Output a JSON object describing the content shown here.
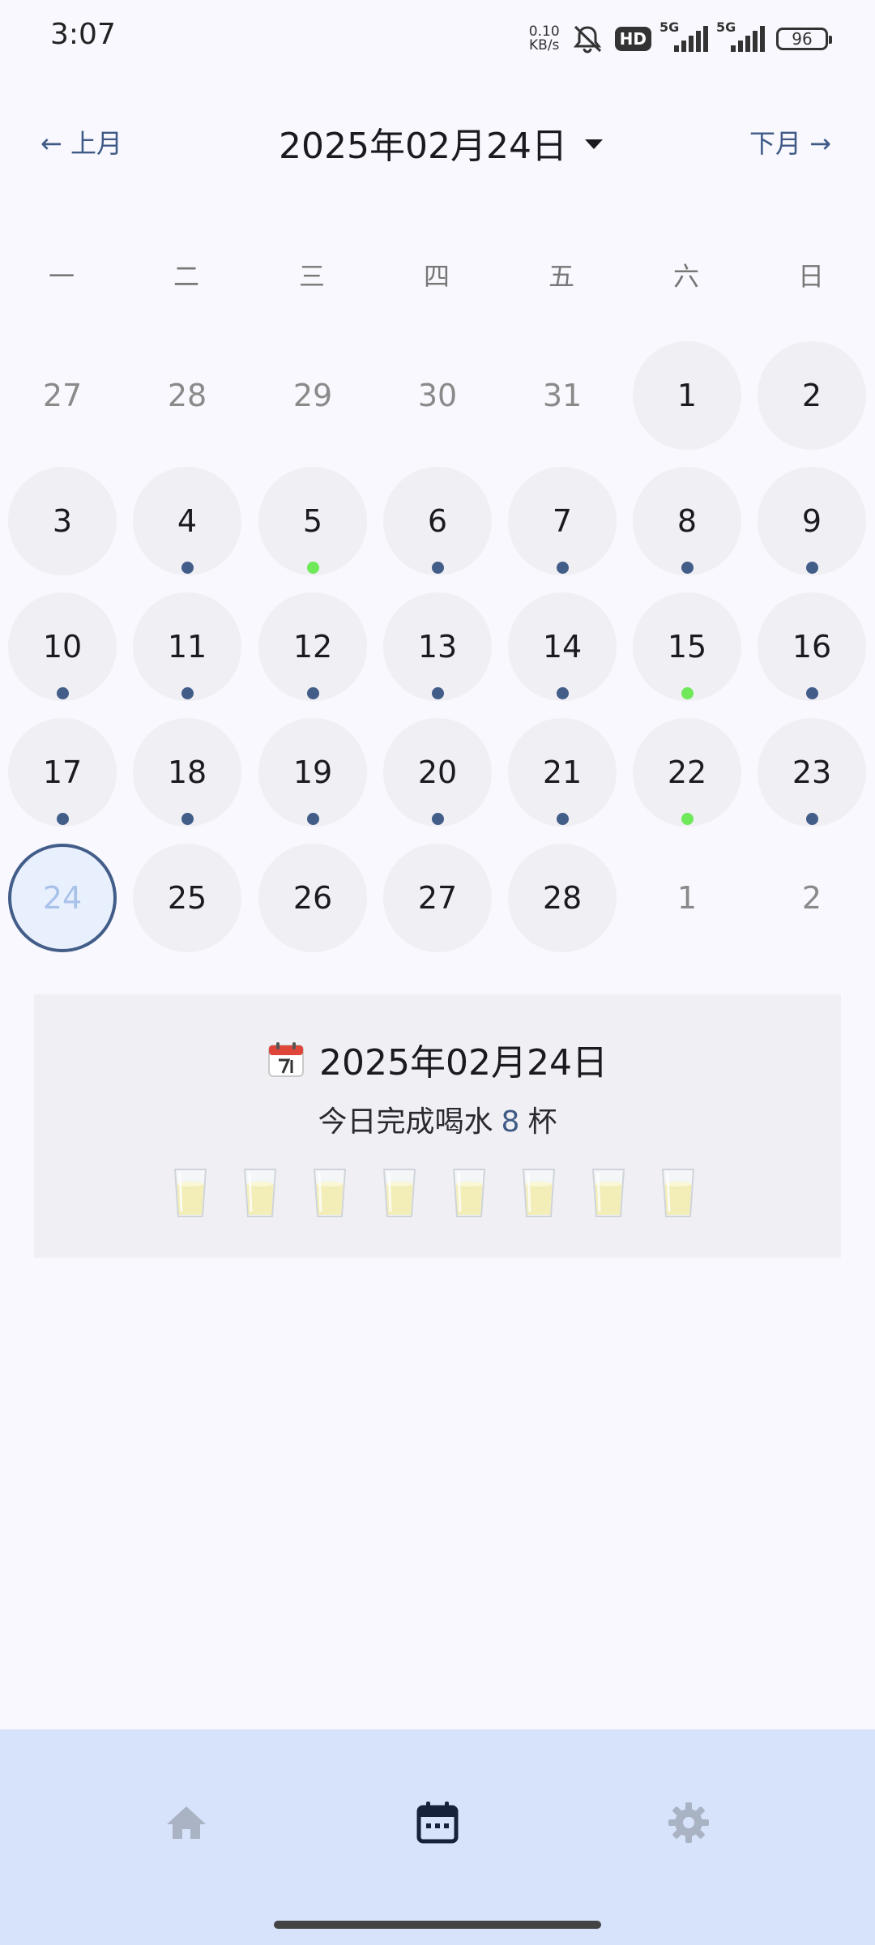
{
  "status_bar": {
    "time": "3:07",
    "speed_value": "0.10",
    "speed_unit": "KB/s",
    "hd_label": "HD",
    "signal1_label": "5G",
    "signal2_label": "5G",
    "battery": "96",
    "icons": [
      "mute-icon",
      "hd-icon",
      "signal-icon",
      "signal-icon",
      "battery-icon"
    ]
  },
  "header": {
    "prev_label": "← 上月",
    "next_label": "下月 →",
    "current_date": "2025年02月24日"
  },
  "weekdays": [
    "一",
    "二",
    "三",
    "四",
    "五",
    "六",
    "日"
  ],
  "calendar": {
    "rows": [
      [
        {
          "d": "27",
          "m": "prev"
        },
        {
          "d": "28",
          "m": "prev"
        },
        {
          "d": "29",
          "m": "prev"
        },
        {
          "d": "30",
          "m": "prev"
        },
        {
          "d": "31",
          "m": "prev"
        },
        {
          "d": "1",
          "m": "cur"
        },
        {
          "d": "2",
          "m": "cur"
        }
      ],
      [
        {
          "d": "3",
          "m": "cur"
        },
        {
          "d": "4",
          "m": "cur",
          "dot": "blue"
        },
        {
          "d": "5",
          "m": "cur",
          "dot": "green"
        },
        {
          "d": "6",
          "m": "cur",
          "dot": "blue"
        },
        {
          "d": "7",
          "m": "cur",
          "dot": "blue"
        },
        {
          "d": "8",
          "m": "cur",
          "dot": "blue"
        },
        {
          "d": "9",
          "m": "cur",
          "dot": "blue"
        }
      ],
      [
        {
          "d": "10",
          "m": "cur",
          "dot": "blue"
        },
        {
          "d": "11",
          "m": "cur",
          "dot": "blue"
        },
        {
          "d": "12",
          "m": "cur",
          "dot": "blue"
        },
        {
          "d": "13",
          "m": "cur",
          "dot": "blue"
        },
        {
          "d": "14",
          "m": "cur",
          "dot": "blue"
        },
        {
          "d": "15",
          "m": "cur",
          "dot": "green"
        },
        {
          "d": "16",
          "m": "cur",
          "dot": "blue"
        }
      ],
      [
        {
          "d": "17",
          "m": "cur",
          "dot": "blue"
        },
        {
          "d": "18",
          "m": "cur",
          "dot": "blue"
        },
        {
          "d": "19",
          "m": "cur",
          "dot": "blue"
        },
        {
          "d": "20",
          "m": "cur",
          "dot": "blue"
        },
        {
          "d": "21",
          "m": "cur",
          "dot": "blue"
        },
        {
          "d": "22",
          "m": "cur",
          "dot": "green"
        },
        {
          "d": "23",
          "m": "cur",
          "dot": "blue"
        }
      ],
      [
        {
          "d": "24",
          "m": "cur",
          "selected": true
        },
        {
          "d": "25",
          "m": "cur"
        },
        {
          "d": "26",
          "m": "cur"
        },
        {
          "d": "27",
          "m": "cur"
        },
        {
          "d": "28",
          "m": "cur"
        },
        {
          "d": "1",
          "m": "next"
        },
        {
          "d": "2",
          "m": "next"
        }
      ]
    ]
  },
  "summary": {
    "date": "2025年02月24日",
    "count_prefix": "今日完成喝水",
    "count": "8",
    "count_suffix": "杯",
    "cups": 8
  },
  "bottom_nav": {
    "items": [
      {
        "icon": "home-icon",
        "active": false
      },
      {
        "icon": "calendar-icon",
        "active": true
      },
      {
        "icon": "settings-icon",
        "active": false
      }
    ]
  },
  "colors": {
    "accent": "#435d89",
    "dot_green": "#6fe85a",
    "nav_bg": "#D7E2FB",
    "background": "#F8F8FE"
  }
}
